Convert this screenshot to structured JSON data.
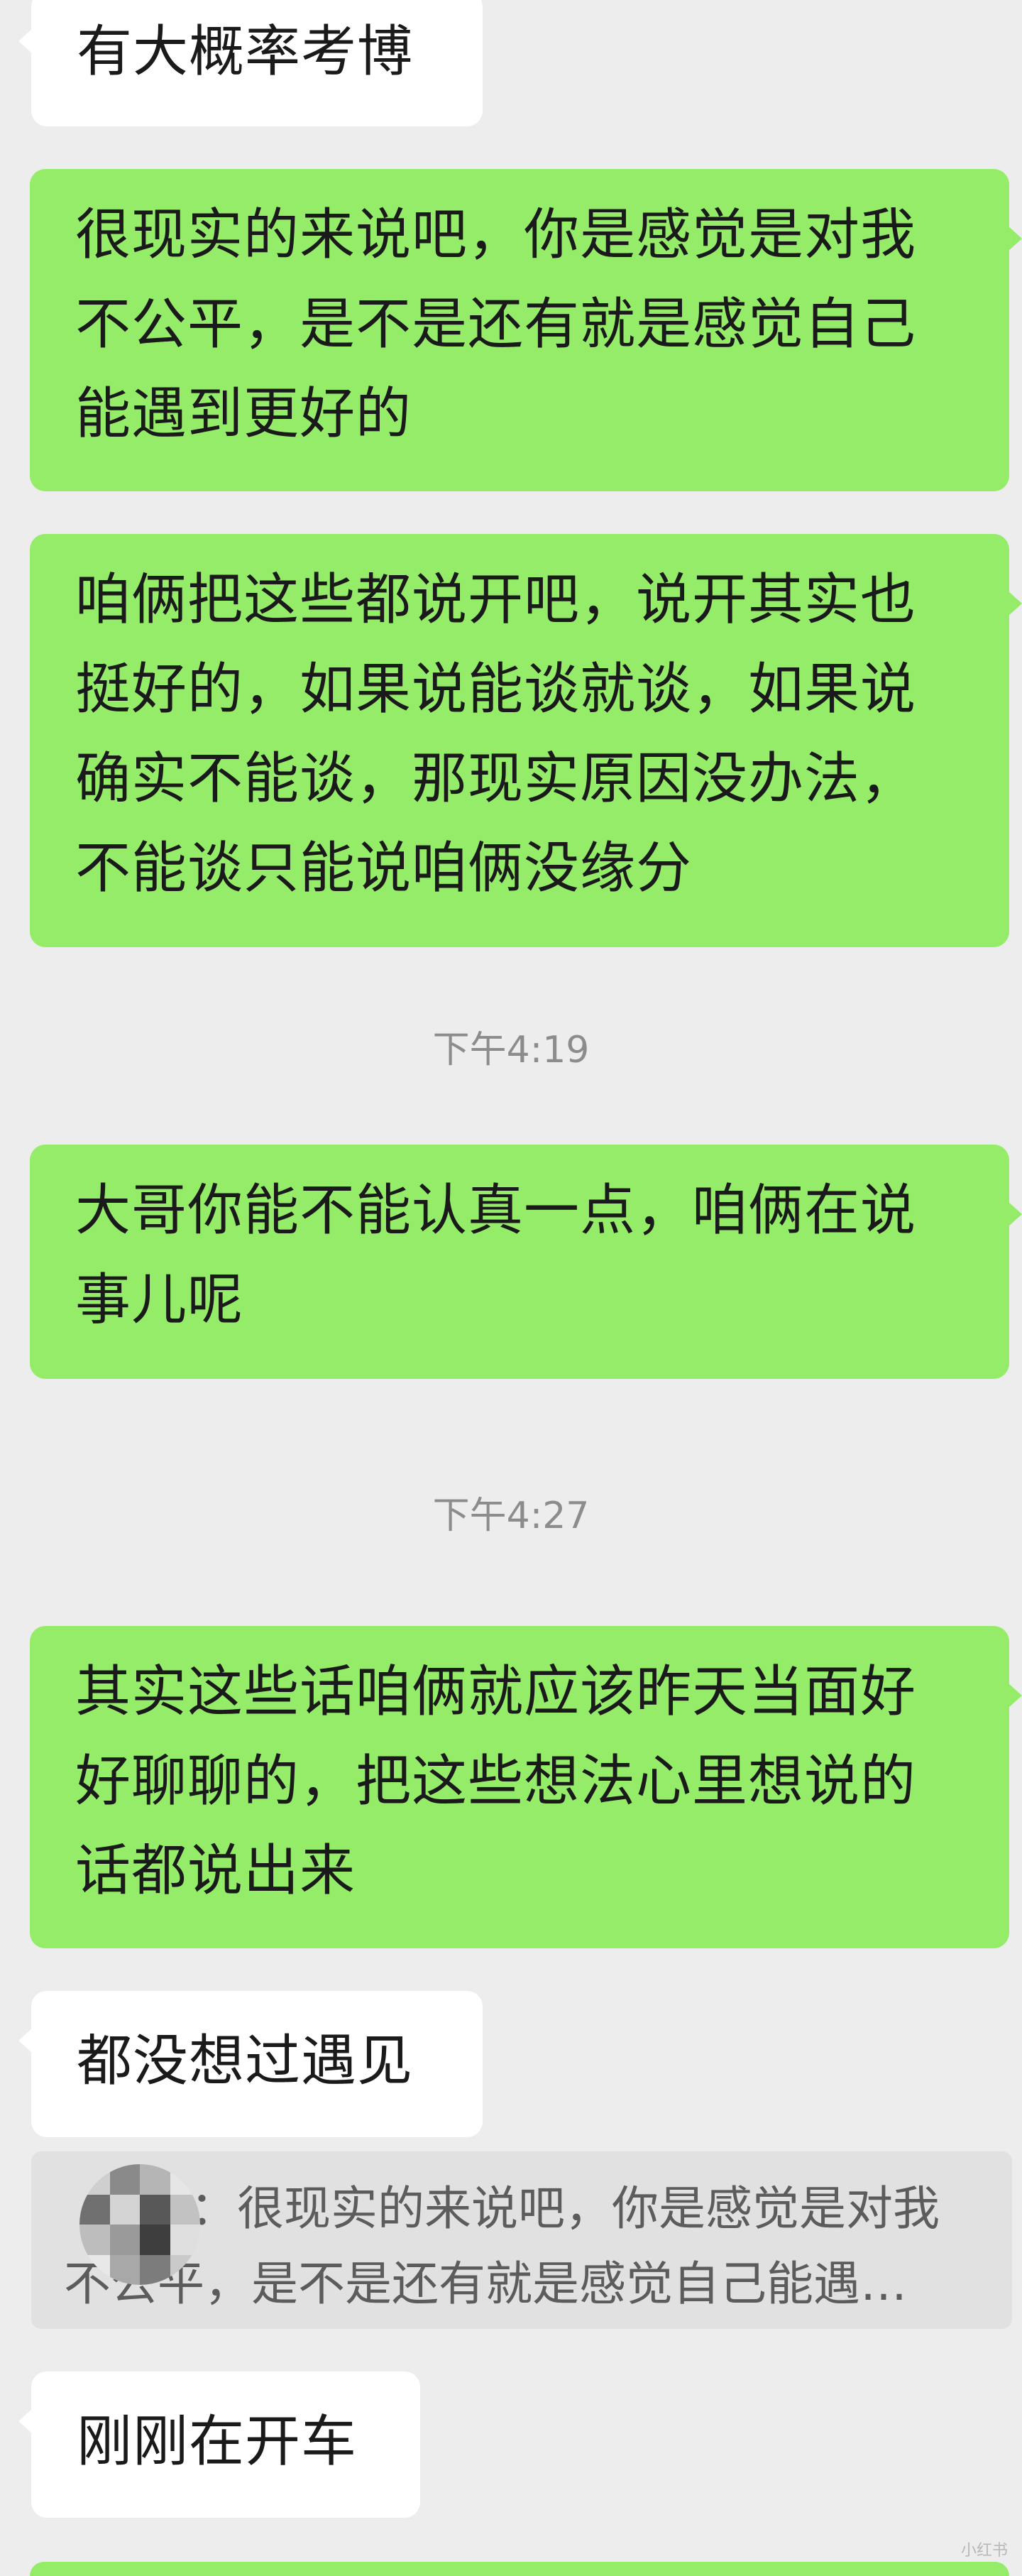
{
  "messages": [
    {
      "side": "left",
      "text": "有大概率考博"
    },
    {
      "side": "right",
      "text": "很现实的来说吧，你是感觉是对我\n不公平，是不是还有就是感觉自己\n能遇到更好的"
    },
    {
      "side": "right",
      "text": "咱俩把这些都说开吧，说开其实也\n挺好的，如果说能谈就谈，如果说\n确实不能谈，那现实原因没办法，\n不能谈只能说咱俩没缘分"
    },
    {
      "side": "right",
      "text": "大哥你能不能认真一点，咱俩在说\n事儿呢"
    },
    {
      "side": "right",
      "text": "其实这些话咱俩就应该昨天当面好\n好聊聊的，把这些想法心里想说的\n话都说出来"
    },
    {
      "side": "left",
      "text": "都没想过遇见"
    },
    {
      "side": "left",
      "text": "刚刚在开车"
    }
  ],
  "timestamps": [
    "下午4:19",
    "下午4:27"
  ],
  "quote": {
    "text": "：很现实的来说吧，你是感觉是对我不公平，是不是还有就是感觉自己能遇…"
  },
  "watermark": "小红书"
}
